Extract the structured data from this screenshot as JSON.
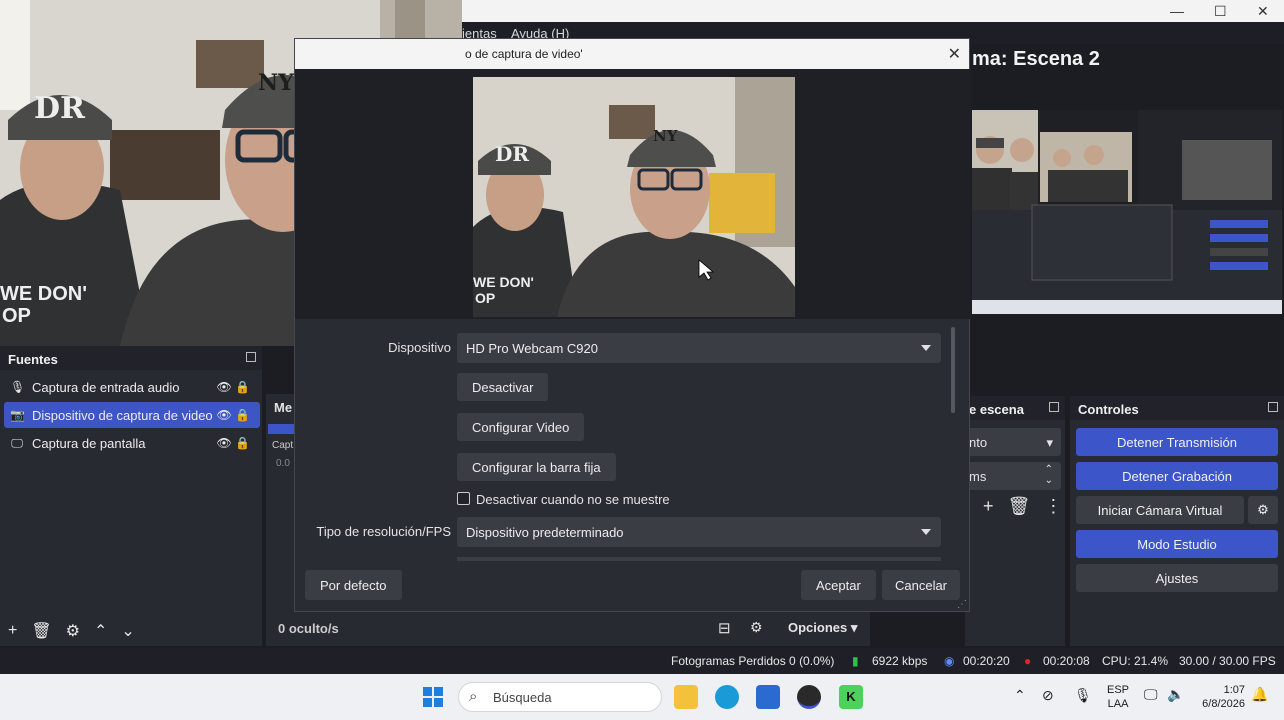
{
  "window": {
    "menu_tools": "ientas",
    "menu_help": "Ayuda (H)",
    "program_label": "ma: Escena 2"
  },
  "dialog": {
    "title": "o de captura de video'",
    "device_label": "Dispositivo",
    "device_value": "HD Pro Webcam C920",
    "deactivate_button": "Desactivar",
    "configure_video_button": "Configurar Video",
    "configure_crossbar_button": "Configurar la barra fija",
    "hide_checkbox_label": "Desactivar cuando no se muestre",
    "resolution_label": "Tipo de resolución/FPS",
    "resolution_value": "Dispositivo predeterminado",
    "defaults_button": "Por defecto",
    "accept_button": "Aceptar",
    "cancel_button": "Cancelar"
  },
  "sources": {
    "title": "Fuentes",
    "items": [
      {
        "label": "Captura de entrada audio",
        "icon": "microphone-icon",
        "selected": false
      },
      {
        "label": "Dispositivo de captura de video",
        "icon": "camera-icon",
        "selected": true
      },
      {
        "label": "Captura de pantalla",
        "icon": "monitor-icon",
        "selected": false
      }
    ]
  },
  "mixer": {
    "title": "Me",
    "row_label": "Capt",
    "row_value": "0.0",
    "hidden_label": "0 oculto/s",
    "options_label": "Opciones"
  },
  "transitions": {
    "title": "e escena",
    "select_value": "nto",
    "duration_value": "ms"
  },
  "controls": {
    "title": "Controles",
    "stop_stream": "Detener Transmisión",
    "stop_recording": "Detener Grabación",
    "start_virtual_cam": "Iniciar Cámara Virtual",
    "studio_mode": "Modo Estudio",
    "settings": "Ajustes"
  },
  "status": {
    "dropped_frames": "Fotogramas Perdidos 0 (0.0%)",
    "bitrate": "6922 kbps",
    "stream_time": "00:20:20",
    "record_time": "00:20:08",
    "cpu": "CPU: 21.4%",
    "fps": "30.00 / 30.00 FPS"
  },
  "taskbar": {
    "search_placeholder": "Búsqueda",
    "lang_top": "ESP",
    "lang_bottom": "LAA",
    "time": "1:07",
    "date": "6/8/2026"
  },
  "colors": {
    "accent_blue": "#3c55c9",
    "panel": "#272a31",
    "record_red": "#e0242c",
    "signal_green": "#2ec24a"
  }
}
